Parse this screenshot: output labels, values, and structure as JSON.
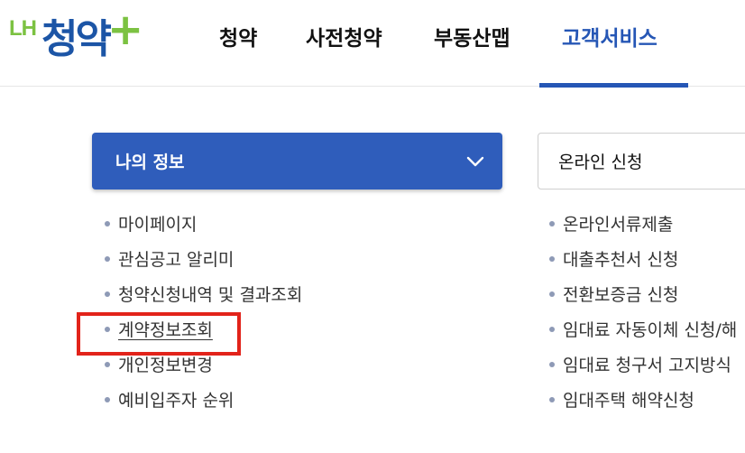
{
  "logo": {
    "lh": "LH",
    "main": "청약",
    "plus": "+"
  },
  "nav": {
    "items": [
      "청약",
      "사전청약",
      "부동산맵",
      "고객서비스"
    ],
    "active_index": 3
  },
  "left_panel": {
    "select_label": "나의 정보",
    "items": [
      "마이페이지",
      "관심공고 알리미",
      "청약신청내역 및 결과조회",
      "계약정보조회",
      "개인정보변경",
      "예비입주자 순위"
    ],
    "selected_index": 3
  },
  "right_panel": {
    "select_label": "온라인 신청",
    "items": [
      "온라인서류제출",
      "대출추천서 신청",
      "전환보증금 신청",
      "임대료 자동이체 신청/해",
      "임대료 청구서 고지방식",
      "임대주택 해약신청"
    ]
  },
  "colors": {
    "brand_blue": "#2556b5",
    "brand_green": "#7cc242",
    "highlight_red": "#e2231a",
    "bullet": "#8e9ab6"
  },
  "icons": {
    "dropdown": "chevron-down-icon"
  }
}
